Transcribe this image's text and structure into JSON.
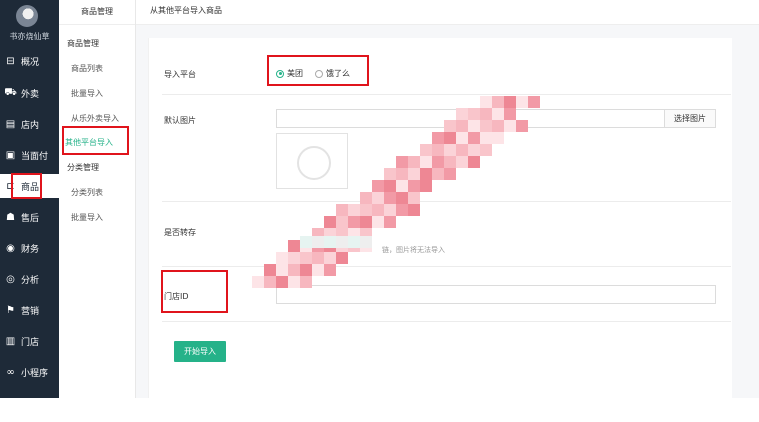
{
  "sidebar": {
    "shop_name": "书亦烧仙草",
    "items": [
      {
        "label": "概况",
        "icon": "dashboard-icon"
      },
      {
        "label": "外卖",
        "icon": "delivery-icon"
      },
      {
        "label": "店内",
        "icon": "store-icon"
      },
      {
        "label": "当面付",
        "icon": "pay-icon"
      },
      {
        "label": "商品",
        "icon": "goods-icon"
      },
      {
        "label": "售后",
        "icon": "aftersale-icon"
      },
      {
        "label": "财务",
        "icon": "finance-icon"
      },
      {
        "label": "分析",
        "icon": "analytics-icon"
      },
      {
        "label": "营销",
        "icon": "marketing-icon"
      },
      {
        "label": "门店",
        "icon": "shop-icon"
      },
      {
        "label": "小程序",
        "icon": "miniprogram-icon"
      }
    ]
  },
  "subnav": {
    "title": "商品管理",
    "items": [
      {
        "label": "商品管理"
      },
      {
        "label": "商品列表"
      },
      {
        "label": "批量导入"
      },
      {
        "label": "从乐外卖导入"
      },
      {
        "label": "其他平台导入"
      },
      {
        "label": "分类管理"
      },
      {
        "label": "分类列表"
      },
      {
        "label": "批量导入"
      }
    ]
  },
  "header": {
    "title": "从其他平台导入商品"
  },
  "form": {
    "platform_label": "导入平台",
    "platform_options": [
      {
        "label": "美团",
        "selected": true
      },
      {
        "label": "饿了么",
        "selected": false
      }
    ],
    "default_image_label": "默认图片",
    "choose_image_button": "选择图片",
    "transfer_label": "是否转存",
    "transfer_hint": "链，图片将无法导入",
    "store_id_label": "门店ID",
    "store_id_value": "",
    "start_button": "开始导入"
  },
  "colors": {
    "accent": "#25b289",
    "sidebar_bg": "#1e2a38",
    "highlight": "#e0141c"
  }
}
